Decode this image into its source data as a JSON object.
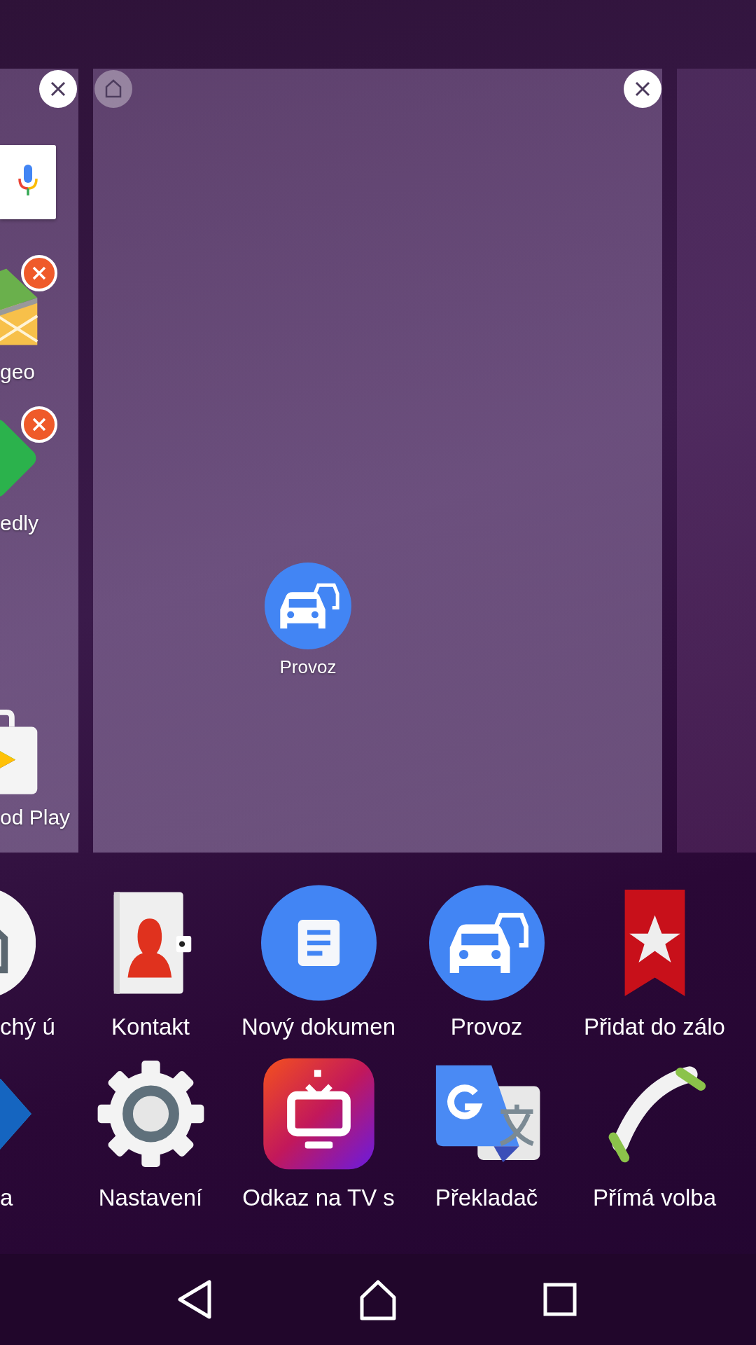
{
  "home_pages": [
    {
      "is_home": false,
      "items": [
        {
          "kind": "search"
        },
        {
          "kind": "map",
          "label": "geo",
          "removable": true
        },
        {
          "kind": "feed",
          "label": "edly",
          "removable": true
        },
        {
          "kind": "store",
          "label": "od Play",
          "removable": false
        }
      ]
    },
    {
      "is_home": true,
      "items": [
        {
          "kind": "traffic",
          "label": "Provoz",
          "removable": false
        }
      ]
    },
    {
      "is_home": false
    }
  ],
  "shortcut_rows": [
    [
      {
        "kind": "house",
        "label": "chý ú"
      },
      {
        "kind": "contact",
        "label": "Kontakt"
      },
      {
        "kind": "document",
        "label": "Nový dokumen"
      },
      {
        "kind": "traffic",
        "label": "Provoz"
      },
      {
        "kind": "bookmark",
        "label": "Přidat do zálo"
      }
    ],
    [
      {
        "kind": "book",
        "label": "a"
      },
      {
        "kind": "settings",
        "label": "Nastavení"
      },
      {
        "kind": "tv",
        "label": "Odkaz na TV s"
      },
      {
        "kind": "translate",
        "label": "Překladač"
      },
      {
        "kind": "phone",
        "label": "Přímá volba"
      }
    ]
  ]
}
